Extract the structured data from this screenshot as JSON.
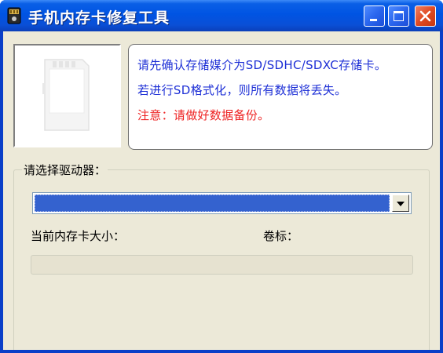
{
  "window": {
    "title": "手机内存卡修复工具",
    "icon": "app-icon",
    "controls": [
      "minimize-icon",
      "maximize-icon",
      "close-icon"
    ]
  },
  "info": {
    "line1": "请先确认存储媒介为SD/SDHC/SDXC存储卡。",
    "line2": "若进行SD格式化，则所有数据将丢失。",
    "line3": "注意：请做好数据备份。",
    "line_colors": [
      "#1d2fd6",
      "#1d2fd6",
      "#ee2222"
    ]
  },
  "drive_group": {
    "label": "请选择驱动器：",
    "selected_value": ""
  },
  "labels": {
    "card_size": "当前内存卡大小：",
    "volume_label": "卷标："
  },
  "progress": {
    "value": 0
  },
  "colors": {
    "titlebar": "#0054e3",
    "client_bg": "#ece9d8",
    "close_button": "#e04a22",
    "selection": "#3462cf"
  }
}
